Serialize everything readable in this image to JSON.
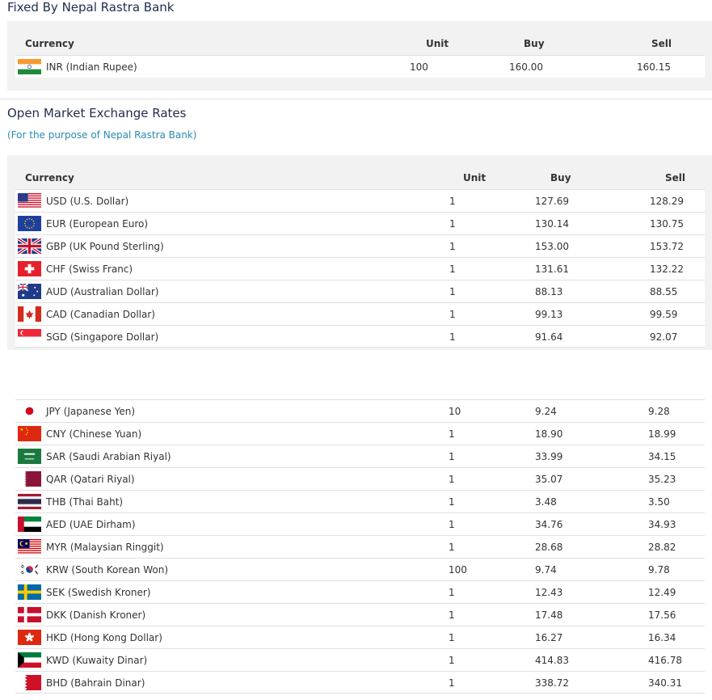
{
  "fixed": {
    "title": "Fixed By Nepal Rastra Bank",
    "headers": {
      "currency": "Currency",
      "unit": "Unit",
      "buy": "Buy",
      "sell": "Sell"
    },
    "rows": [
      {
        "code": "INR",
        "name": "INR (Indian Rupee)",
        "unit": "100",
        "buy": "160.00",
        "sell": "160.15"
      }
    ]
  },
  "open": {
    "title": "Open Market Exchange Rates",
    "subtitle": "(For the purpose of Nepal Rastra Bank)",
    "headers": {
      "currency": "Currency",
      "unit": "Unit",
      "buy": "Buy",
      "sell": "Sell"
    },
    "rows": [
      {
        "code": "USD",
        "name": "USD (U.S. Dollar)",
        "unit": "1",
        "buy": "127.69",
        "sell": "128.29"
      },
      {
        "code": "EUR",
        "name": "EUR (European Euro)",
        "unit": "1",
        "buy": "130.14",
        "sell": "130.75"
      },
      {
        "code": "GBP",
        "name": "GBP (UK Pound Sterling)",
        "unit": "1",
        "buy": "153.00",
        "sell": "153.72"
      },
      {
        "code": "CHF",
        "name": "CHF (Swiss Franc)",
        "unit": "1",
        "buy": "131.61",
        "sell": "132.22"
      },
      {
        "code": "AUD",
        "name": "AUD (Australian Dollar)",
        "unit": "1",
        "buy": "88.13",
        "sell": "88.55"
      },
      {
        "code": "CAD",
        "name": "CAD (Canadian Dollar)",
        "unit": "1",
        "buy": "99.13",
        "sell": "99.59"
      },
      {
        "code": "SGD",
        "name": "SGD (Singapore Dollar)",
        "unit": "1",
        "buy": "91.64",
        "sell": "92.07"
      }
    ],
    "rows2": [
      {
        "code": "JPY",
        "name": "JPY (Japanese Yen)",
        "unit": "10",
        "buy": "9.24",
        "sell": "9.28"
      },
      {
        "code": "CNY",
        "name": "CNY (Chinese Yuan)",
        "unit": "1",
        "buy": "18.90",
        "sell": "18.99"
      },
      {
        "code": "SAR",
        "name": "SAR (Saudi Arabian Riyal)",
        "unit": "1",
        "buy": "33.99",
        "sell": "34.15"
      },
      {
        "code": "QAR",
        "name": "QAR (Qatari Riyal)",
        "unit": "1",
        "buy": "35.07",
        "sell": "35.23"
      },
      {
        "code": "THB",
        "name": "THB (Thai Baht)",
        "unit": "1",
        "buy": "3.48",
        "sell": "3.50"
      },
      {
        "code": "AED",
        "name": "AED (UAE Dirham)",
        "unit": "1",
        "buy": "34.76",
        "sell": "34.93"
      },
      {
        "code": "MYR",
        "name": "MYR (Malaysian Ringgit)",
        "unit": "1",
        "buy": "28.68",
        "sell": "28.82"
      },
      {
        "code": "KRW",
        "name": "KRW (South Korean Won)",
        "unit": "100",
        "buy": "9.74",
        "sell": "9.78"
      },
      {
        "code": "SEK",
        "name": "SEK (Swedish Kroner)",
        "unit": "1",
        "buy": "12.43",
        "sell": "12.49"
      },
      {
        "code": "DKK",
        "name": "DKK (Danish Kroner)",
        "unit": "1",
        "buy": "17.48",
        "sell": "17.56"
      },
      {
        "code": "HKD",
        "name": "HKD (Hong Kong Dollar)",
        "unit": "1",
        "buy": "16.27",
        "sell": "16.34"
      },
      {
        "code": "KWD",
        "name": "KWD (Kuwaity Dinar)",
        "unit": "1",
        "buy": "414.83",
        "sell": "416.78"
      },
      {
        "code": "BHD",
        "name": "BHD (Bahrain Dinar)",
        "unit": "1",
        "buy": "338.72",
        "sell": "340.31"
      }
    ]
  }
}
